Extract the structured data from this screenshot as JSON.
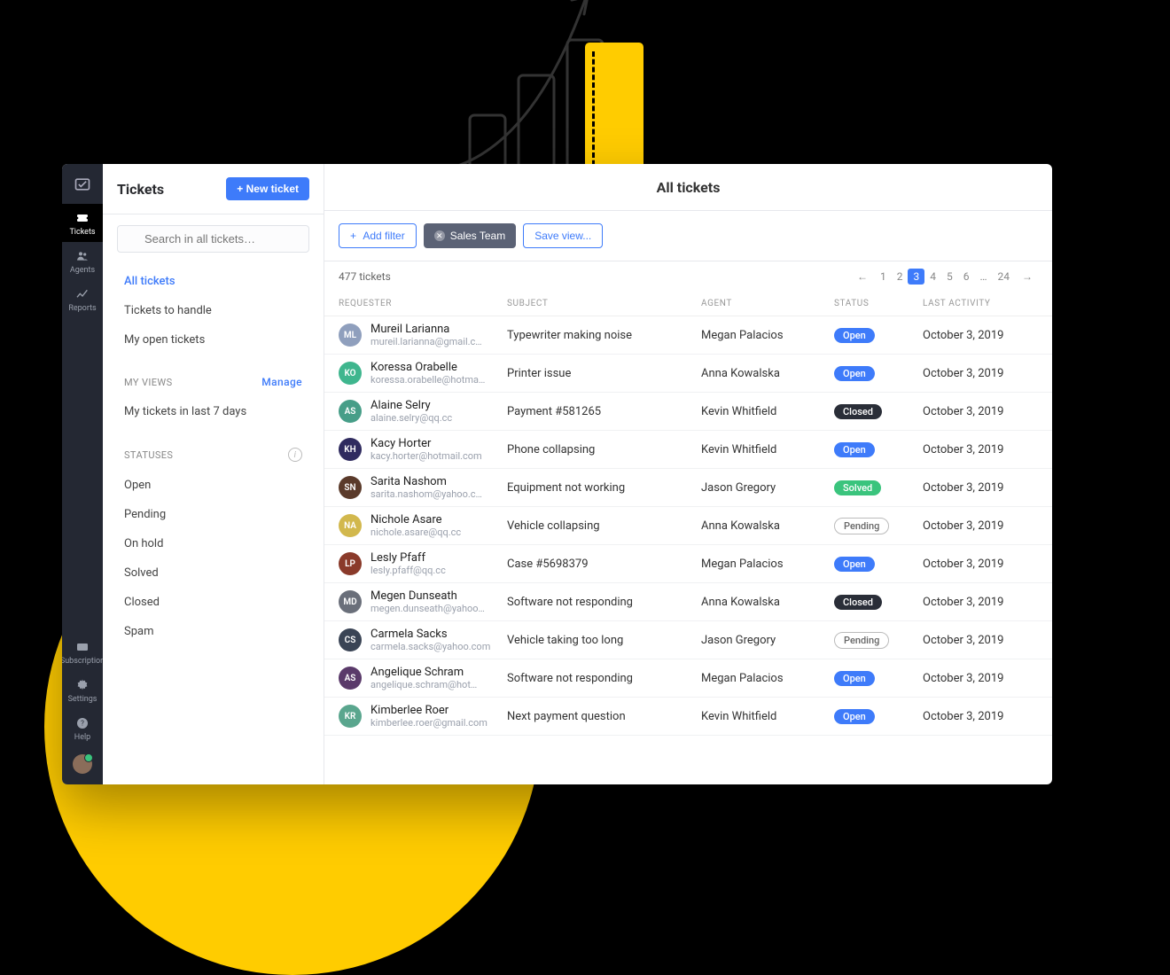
{
  "rail": {
    "items": [
      {
        "label": "Tickets",
        "icon": "ticket"
      },
      {
        "label": "Agents",
        "icon": "agents"
      },
      {
        "label": "Reports",
        "icon": "reports"
      }
    ],
    "bottom": [
      {
        "label": "Subscription",
        "icon": "card"
      },
      {
        "label": "Settings",
        "icon": "gear"
      },
      {
        "label": "Help",
        "icon": "help"
      }
    ]
  },
  "sidebar": {
    "title": "Tickets",
    "new_ticket": "+ New ticket",
    "search_placeholder": "Search in all tickets…",
    "primary_views": [
      {
        "label": "All tickets",
        "active": true
      },
      {
        "label": "Tickets to handle"
      },
      {
        "label": "My open tickets"
      }
    ],
    "my_views_header": "MY VIEWS",
    "manage_label": "Manage",
    "my_views": [
      {
        "label": "My tickets in last 7 days"
      }
    ],
    "statuses_header": "STATUSES",
    "statuses": [
      {
        "label": "Open"
      },
      {
        "label": "Pending"
      },
      {
        "label": "On hold"
      },
      {
        "label": "Solved"
      },
      {
        "label": "Closed"
      },
      {
        "label": "Spam"
      }
    ]
  },
  "main": {
    "title": "All tickets",
    "add_filter": "Add filter",
    "filter_chip": "Sales Team",
    "save_view": "Save view...",
    "count": "477 tickets",
    "pager": {
      "pages": [
        "1",
        "2",
        "3",
        "4",
        "5",
        "6",
        "…",
        "24"
      ],
      "active": "3"
    },
    "columns": {
      "requester": "REQUESTER",
      "subject": "SUBJECT",
      "agent": "AGENT",
      "status": "STATUS",
      "activity": "LAST ACTIVITY"
    },
    "rows": [
      {
        "initials": "ML",
        "color": "#8f9fbd",
        "name": "Mureil Larianna",
        "email": "mureil.larianna@gmail.c…",
        "subject": "Typewriter making noise",
        "agent": "Megan Palacios",
        "status": "Open",
        "date": "October 3, 2019"
      },
      {
        "initials": "KO",
        "color": "#3fb68e",
        "name": "Koressa Orabelle",
        "email": "koressa.orabelle@hotma…",
        "subject": "Printer issue",
        "agent": "Anna Kowalska",
        "status": "Open",
        "date": "October 3, 2019"
      },
      {
        "initials": "AS",
        "color": "#479e88",
        "name": "Alaine Selry",
        "email": "alaine.selry@qq.cc",
        "subject": "Payment #581265",
        "agent": "Kevin Whitfield",
        "status": "Closed",
        "date": "October 3, 2019"
      },
      {
        "initials": "KH",
        "color": "#2f2b5f",
        "name": "Kacy Horter",
        "email": "kacy.horter@hotmail.com",
        "subject": "Phone collapsing",
        "agent": "Kevin Whitfield",
        "status": "Open",
        "date": "October 3, 2019"
      },
      {
        "initials": "SN",
        "color": "#5a3a2a",
        "name": "Sarita Nashom",
        "email": "sarita.nashom@yahoo.c…",
        "subject": "Equipment not working",
        "agent": "Jason Gregory",
        "status": "Solved",
        "date": "October 3, 2019"
      },
      {
        "initials": "NA",
        "color": "#d2b84d",
        "name": "Nichole Asare",
        "email": "nichole.asare@qq.cc",
        "subject": "Vehicle collapsing",
        "agent": "Anna Kowalska",
        "status": "Pending",
        "date": "October 3, 2019"
      },
      {
        "initials": "LP",
        "color": "#8a3a2a",
        "name": "Lesly Pfaff",
        "email": "lesly.pfaff@qq.cc",
        "subject": "Case #5698379",
        "agent": "Megan Palacios",
        "status": "Open",
        "date": "October 3, 2019"
      },
      {
        "initials": "MD",
        "color": "#6a6f7a",
        "name": "Megen Dunseath",
        "email": "megen.dunseath@yahoo…",
        "subject": "Software not responding",
        "agent": "Anna Kowalska",
        "status": "Closed",
        "date": "October 3, 2019"
      },
      {
        "initials": "CS",
        "color": "#3a4455",
        "name": "Carmela Sacks",
        "email": "carmela.sacks@yahoo.com",
        "subject": "Vehicle taking too long",
        "agent": "Jason Gregory",
        "status": "Pending",
        "date": "October 3, 2019"
      },
      {
        "initials": "AS",
        "color": "#5a3a6a",
        "name": "Angelique Schram",
        "email": "angelique.schram@hot…",
        "subject": "Software not responding",
        "agent": "Megan Palacios",
        "status": "Open",
        "date": "October 3, 2019"
      },
      {
        "initials": "KR",
        "color": "#5aa68e",
        "name": "Kimberlee Roer",
        "email": "kimberlee.roer@gmail.com",
        "subject": "Next payment question",
        "agent": "Kevin Whitfield",
        "status": "Open",
        "date": "October 3, 2019"
      }
    ]
  }
}
